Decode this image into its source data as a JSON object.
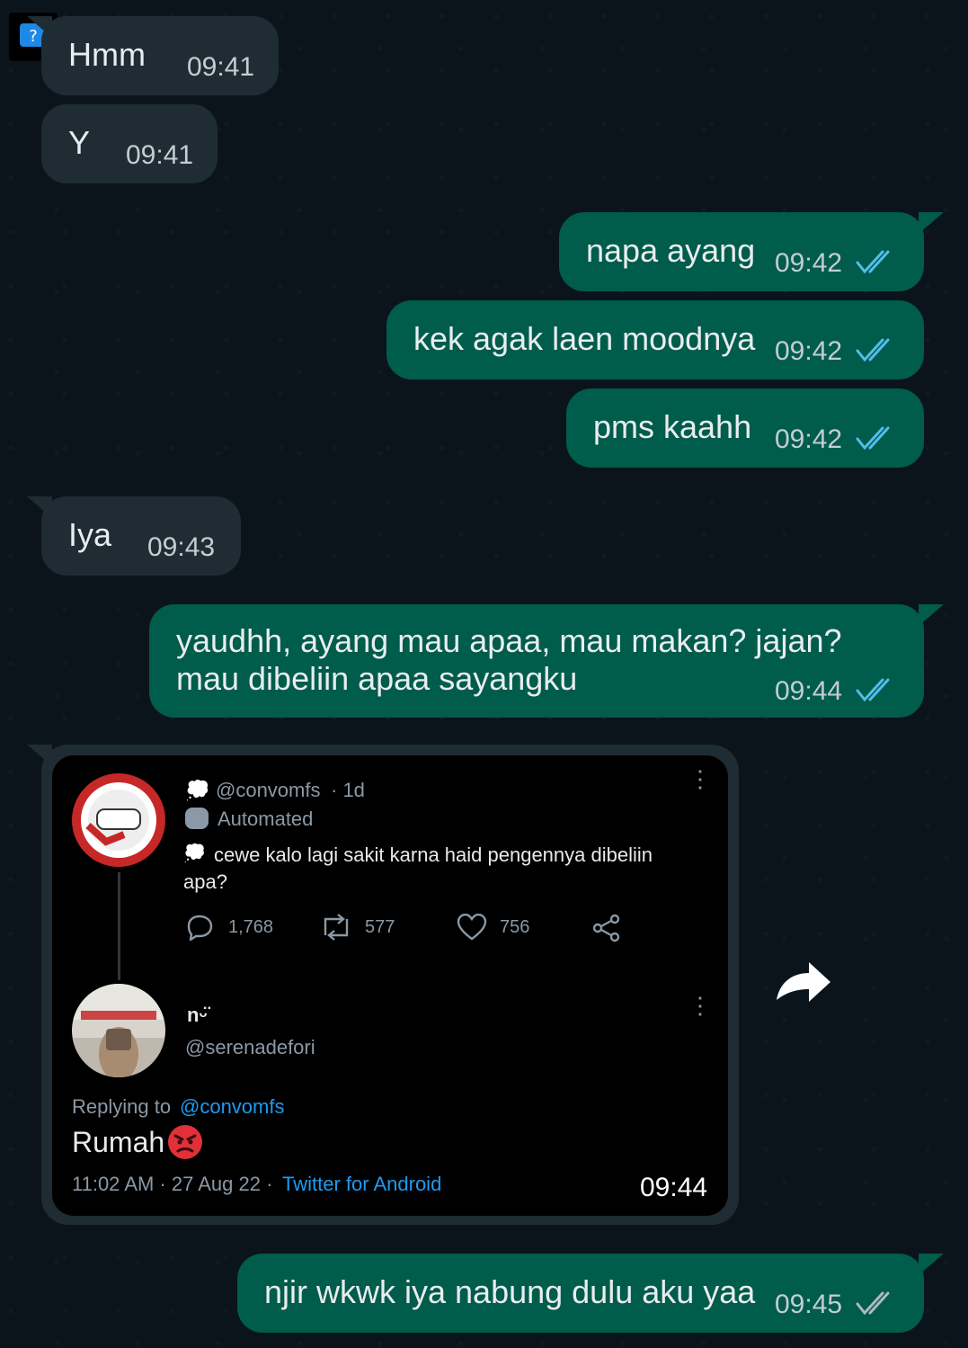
{
  "chat": {
    "messages": [
      {
        "direction": "in",
        "text": "Hmm",
        "time": "09:41"
      },
      {
        "direction": "in",
        "text": "Y",
        "time": "09:41"
      },
      {
        "direction": "out",
        "text": "napa ayang",
        "time": "09:42",
        "status": "read"
      },
      {
        "direction": "out",
        "text": "kek agak laen moodnya",
        "time": "09:42",
        "status": "read"
      },
      {
        "direction": "out",
        "text": "pms kaahh",
        "time": "09:42",
        "status": "read"
      },
      {
        "direction": "in",
        "text": "Iya",
        "time": "09:43"
      },
      {
        "direction": "out",
        "text_line1": "yaudhh, ayang mau apaa, mau makan? jajan?",
        "text_line2": "mau dibeliin apaa sayangku",
        "time": "09:44",
        "status": "read"
      },
      {
        "direction": "in",
        "type": "image",
        "time": "09:44"
      },
      {
        "direction": "out",
        "text": "njir wkwk iya nabung dulu aku yaa",
        "time": "09:45",
        "status": "delivered"
      }
    ]
  },
  "tweet": {
    "op_handle": "@convomfs",
    "op_age": "· 1d",
    "op_label": "Automated",
    "op_text_line1": "cewe kalo lagi sakit karna haid pengennya dibeliin",
    "op_text_line2": "apa?",
    "replies": "1,768",
    "retweets": "577",
    "likes": "756",
    "reply_name": "n",
    "reply_name_suffix": "ᵕ̈",
    "reply_handle": "@serenadefori",
    "replying_to_label": "Replying to",
    "replying_to_handle": "@convomfs",
    "reply_text": "Rumah",
    "meta_time": "11:02 AM · 27 Aug 22 ·",
    "meta_source": "Twitter for Android"
  },
  "colors": {
    "background": "#0b141a",
    "incoming": "#202c33",
    "outgoing": "#005c4b",
    "read_ticks": "#53bdeb",
    "delivered_ticks": "#aebac1",
    "twitter_blue": "#1d9bf0"
  }
}
